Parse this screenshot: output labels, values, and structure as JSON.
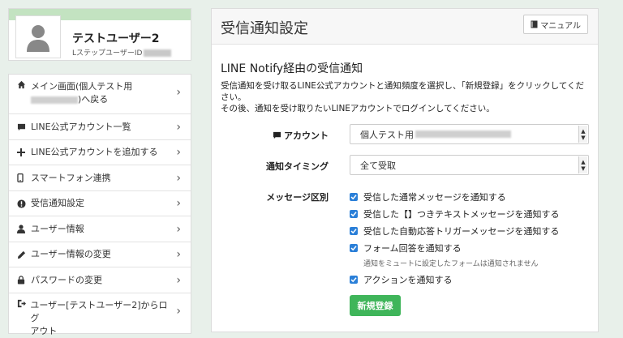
{
  "profile": {
    "name": "テストユーザー2",
    "id_label": "LステップユーザーID"
  },
  "menu": {
    "items": [
      {
        "icon": "home-icon",
        "label_line1": "メイン画面(個人テスト用",
        "label_line2": ")へ戻る"
      },
      {
        "icon": "chat-bubble-icon",
        "label": "LINE公式アカウント一覧"
      },
      {
        "icon": "plus-icon",
        "label": "LINE公式アカウントを追加する"
      },
      {
        "icon": "smartphone-icon",
        "label": "スマートフォン連携"
      },
      {
        "icon": "alert-circle-icon",
        "label": "受信通知設定"
      },
      {
        "icon": "user-icon",
        "label": "ユーザー情報"
      },
      {
        "icon": "pencil-icon",
        "label": "ユーザー情報の変更"
      },
      {
        "icon": "lock-icon",
        "label": "パスワードの変更"
      },
      {
        "icon": "logout-icon",
        "label_line1": "ユーザー[テストユーザー2]からログ",
        "label_line2": "アウト"
      }
    ]
  },
  "panel": {
    "title": "受信通知設定",
    "manual_label": "マニュアル",
    "section_title": "LINE Notify経由の受信通知",
    "desc1": "受信通知を受け取るLINE公式アカウントと通知頻度を選択し、「新規登録」をクリックしてください。",
    "desc2": "その後、通知を受け取りたいLINEアカウントでログインしてください。",
    "account_label": "アカウント",
    "account_value": "個人テスト用",
    "timing_label": "通知タイミング",
    "timing_value": "全て受取",
    "message_label": "メッセージ区別",
    "options": [
      "受信した通常メッセージを通知する",
      "受信した【】つきテキストメッセージを通知する",
      "受信した自動応答トリガーメッセージを通知する",
      "フォーム回答を通知する",
      "アクションを通知する"
    ],
    "form_note": "通知をミュートに設定したフォームは通知されません",
    "submit_label": "新規登録"
  },
  "colors": {
    "accent_green": "#3fb55a",
    "checkbox_blue": "#2a7fd8",
    "profile_bar": "#c3e3c1",
    "page_bg": "#e8f0ea"
  }
}
